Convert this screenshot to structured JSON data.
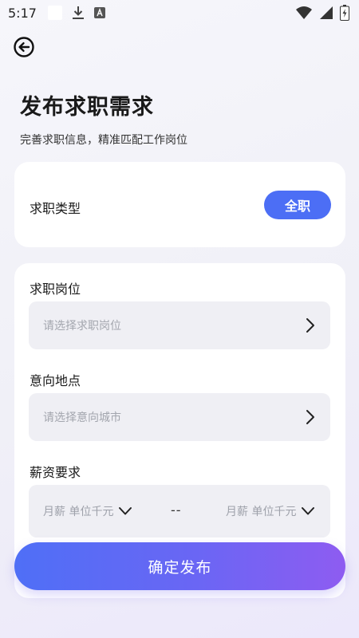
{
  "status_bar": {
    "time": "5:17"
  },
  "header": {
    "title": "发布求职需求",
    "subtitle": "完善求职信息，精准匹配工作岗位"
  },
  "job_type": {
    "label": "求职类型",
    "value": "全职"
  },
  "form": {
    "position": {
      "label": "求职岗位",
      "placeholder": "请选择求职岗位"
    },
    "location": {
      "label": "意向地点",
      "placeholder": "请选择意向城市"
    },
    "salary": {
      "label": "薪资要求",
      "min_placeholder": "月薪 单位千元",
      "separator": "--",
      "max_placeholder": "月薪 单位千元"
    }
  },
  "submit": {
    "label": "确定发布"
  },
  "colors": {
    "accent": "#4c6ef5",
    "gradient_end": "#8e5cf1"
  }
}
